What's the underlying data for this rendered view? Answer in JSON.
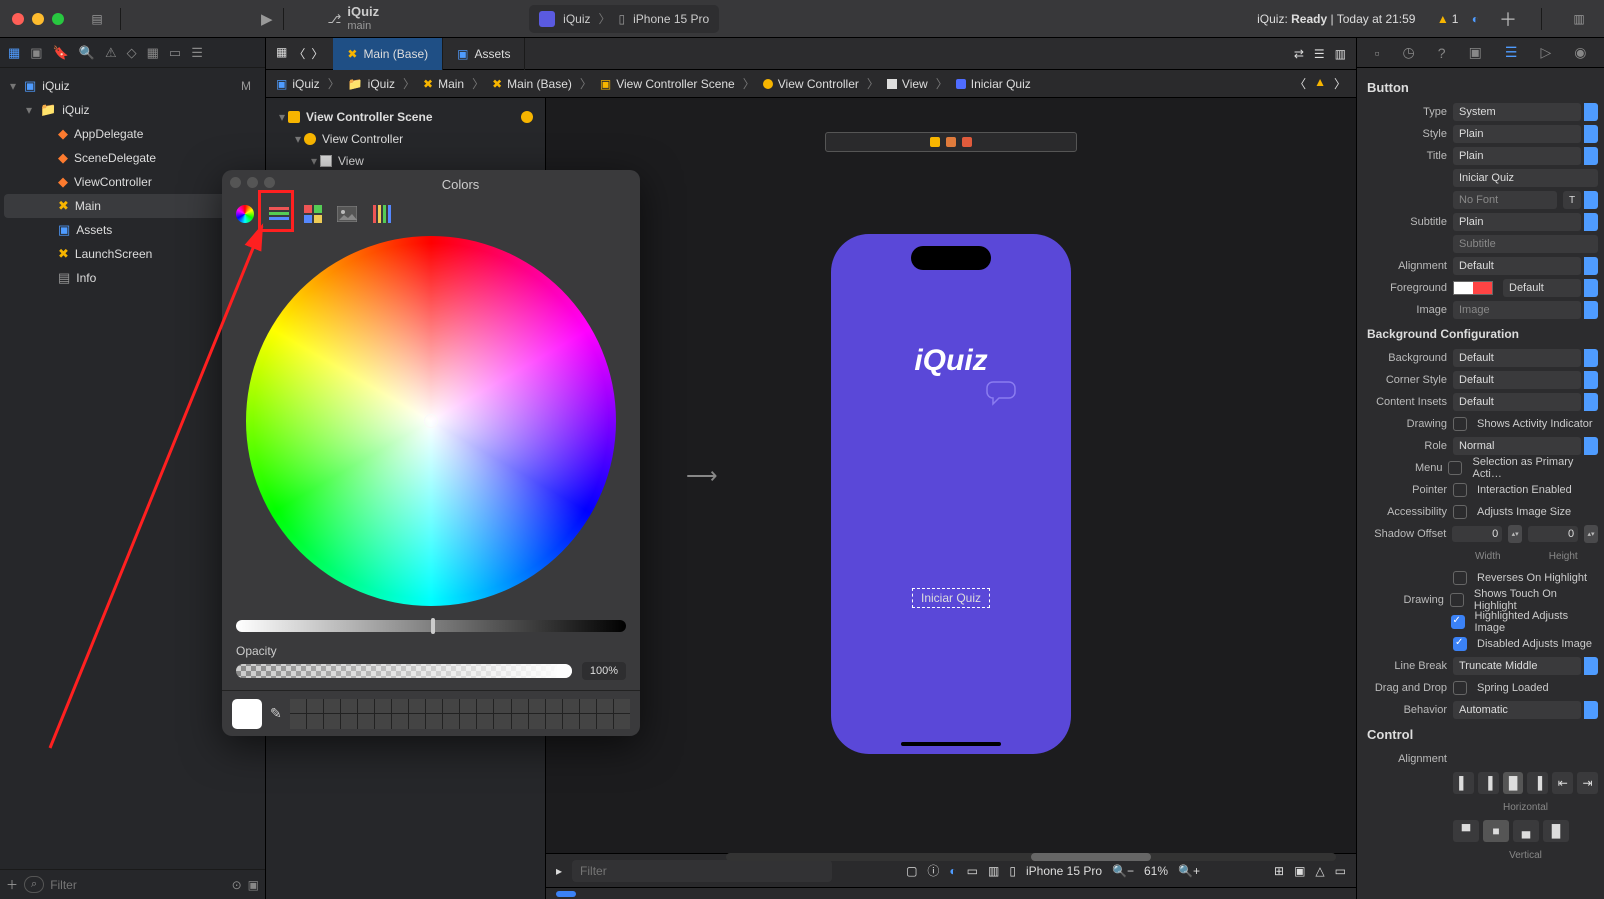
{
  "titlebar": {
    "project": "iQuiz",
    "branch": "main",
    "scheme_app": "iQuiz",
    "scheme_device": "iPhone 15 Pro",
    "status_prefix": "iQuiz: ",
    "status_ready": "Ready",
    "status_time": "Today at 21:59",
    "warn_count": "1"
  },
  "navigator": {
    "root": "iQuiz",
    "group": "iQuiz",
    "files": [
      "AppDelegate",
      "SceneDelegate",
      "ViewController",
      "Main",
      "Assets",
      "LaunchScreen",
      "Info"
    ],
    "modified": "M",
    "filter_placeholder": "Filter"
  },
  "tabs": {
    "main": "Main (Base)",
    "assets": "Assets"
  },
  "jump": {
    "c0": "iQuiz",
    "c1": "iQuiz",
    "c2": "Main",
    "c3": "Main (Base)",
    "c4": "View Controller Scene",
    "c5": "View Controller",
    "c6": "View",
    "c7": "Iniciar Quiz"
  },
  "outline": {
    "scene": "View Controller Scene",
    "vc": "View Controller",
    "view": "View"
  },
  "canvas": {
    "logo": "iQuiz",
    "button": "Iniciar Quiz",
    "device": "iPhone 15 Pro",
    "zoom": "61%",
    "filter_placeholder": "Filter"
  },
  "colors": {
    "title": "Colors",
    "opacity_label": "Opacity",
    "opacity_value": "100%"
  },
  "inspector": {
    "section_button": "Button",
    "type": {
      "label": "Type",
      "value": "System"
    },
    "style": {
      "label": "Style",
      "value": "Plain"
    },
    "title": {
      "label": "Title",
      "value": "Plain",
      "text": "Iniciar Quiz",
      "font_placeholder": "No Font"
    },
    "subtitle": {
      "label": "Subtitle",
      "value": "Plain",
      "placeholder": "Subtitle"
    },
    "alignment": {
      "label": "Alignment",
      "value": "Default"
    },
    "foreground": {
      "label": "Foreground",
      "value": "Default"
    },
    "image": {
      "label": "Image",
      "placeholder": "Image"
    },
    "bg_config": "Background Configuration",
    "background": {
      "label": "Background",
      "value": "Default"
    },
    "corner": {
      "label": "Corner Style",
      "value": "Default"
    },
    "insets": {
      "label": "Content Insets",
      "value": "Default"
    },
    "drawing1": {
      "label": "Drawing",
      "text": "Shows Activity Indicator"
    },
    "role": {
      "label": "Role",
      "value": "Normal"
    },
    "menu": {
      "label": "Menu",
      "text": "Selection as Primary Acti…"
    },
    "pointer": {
      "label": "Pointer",
      "text": "Interaction Enabled"
    },
    "access": {
      "label": "Accessibility",
      "text": "Adjusts Image Size"
    },
    "shadow": {
      "label": "Shadow Offset",
      "w": "0",
      "h": "0",
      "wl": "Width",
      "hl": "Height"
    },
    "rev": "Reverses On Highlight",
    "touch": "Shows Touch On Highlight",
    "hi_adj": "Highlighted Adjusts Image",
    "dis_adj": "Disabled Adjusts Image",
    "drawing2_label": "Drawing",
    "linebreak": {
      "label": "Line Break",
      "value": "Truncate Middle"
    },
    "drag": {
      "label": "Drag and Drop",
      "text": "Spring Loaded"
    },
    "behavior": {
      "label": "Behavior",
      "value": "Automatic"
    },
    "section_control": "Control",
    "ctrl_align": "Alignment",
    "horiz": "Horizontal",
    "vert": "Vertical"
  }
}
